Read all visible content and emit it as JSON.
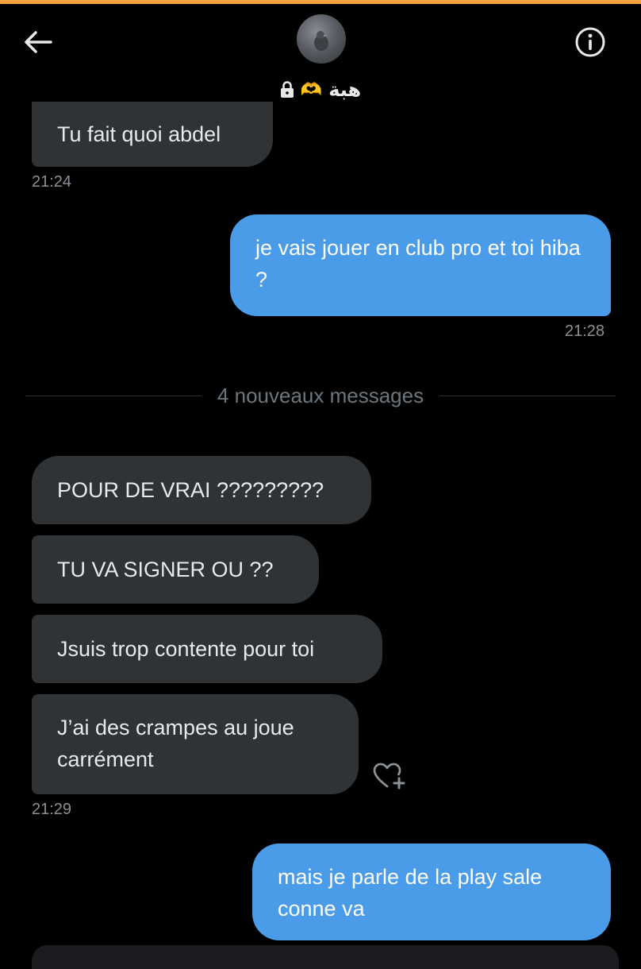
{
  "header": {
    "display_name": "هبة",
    "name_emoji": "🫶",
    "accent_color": "#f5a23a"
  },
  "conversation": {
    "messages": [
      {
        "direction": "incoming",
        "text": "Tu fait quoi abdel",
        "time": "21:24"
      },
      {
        "direction": "outgoing",
        "text": "je vais jouer en club pro et toi hiba ?",
        "time": "21:28"
      },
      {
        "direction": "incoming",
        "text": "POUR DE VRAI ?????????"
      },
      {
        "direction": "incoming",
        "text": "TU VA SIGNER OU ??"
      },
      {
        "direction": "incoming",
        "text": "Jsuis trop contente pour toi"
      },
      {
        "direction": "incoming",
        "text": "J’ai des crampes au joue carrément",
        "time": "21:29"
      },
      {
        "direction": "outgoing",
        "text": "mais je parle de la play sale conne va"
      }
    ],
    "new_messages_divider": "4 nouveaux messages"
  },
  "colors": {
    "background": "#000000",
    "incoming_bubble": "#2f3336",
    "outgoing_bubble": "#4a9be8",
    "timestamp": "#8b9096"
  },
  "icons": {
    "back": "arrow-left-icon",
    "info": "info-icon",
    "lock": "lock-icon",
    "react": "heart-plus-icon"
  }
}
